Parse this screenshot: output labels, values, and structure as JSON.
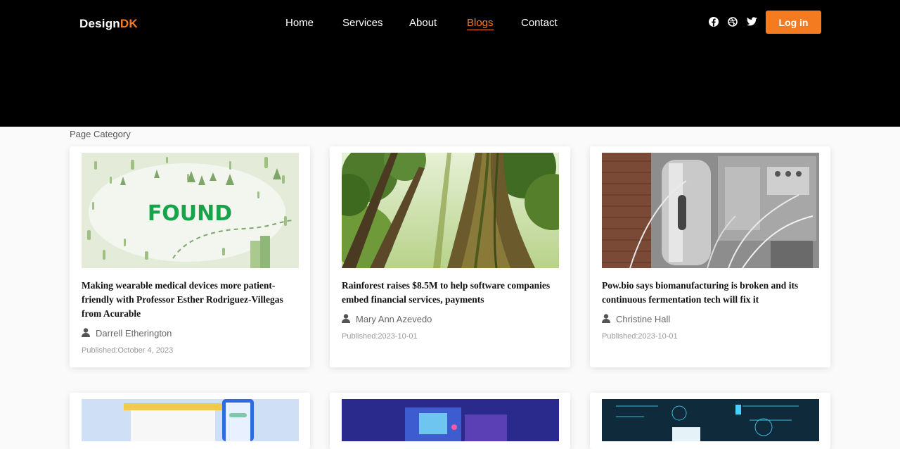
{
  "brand": {
    "name": "Design",
    "accent": "DK"
  },
  "nav": {
    "links": [
      {
        "label": "Home"
      },
      {
        "label": "Services"
      },
      {
        "label": "About"
      },
      {
        "label": "Blogs",
        "active": true
      },
      {
        "label": "Contact"
      }
    ],
    "social_icons": [
      "facebook-icon",
      "dribbble-icon",
      "twitter-icon"
    ],
    "login_label": "Log in"
  },
  "page": {
    "category_label": "Page Category"
  },
  "cards": [
    {
      "image_text": "FOUND",
      "title": "Making wearable medical devices more patient-friendly with Professor Esther Rodriguez-Villegas from Acurable",
      "author": "Darrell Etherington",
      "published": "Published:October 4, 2023"
    },
    {
      "title": "Rainforest raises $8.5M to help software companies embed financial services, payments",
      "author": "Mary Ann Azevedo",
      "published": "Published:2023-10-01"
    },
    {
      "title": "Pow.bio says biomanufacturing is broken and its continuous fermentation tech will fix it",
      "author": "Christine Hall",
      "published": "Published:2023-10-01"
    }
  ],
  "colors": {
    "accent": "#f47b20",
    "navbar": "#000000",
    "found_green": "#1db954"
  }
}
